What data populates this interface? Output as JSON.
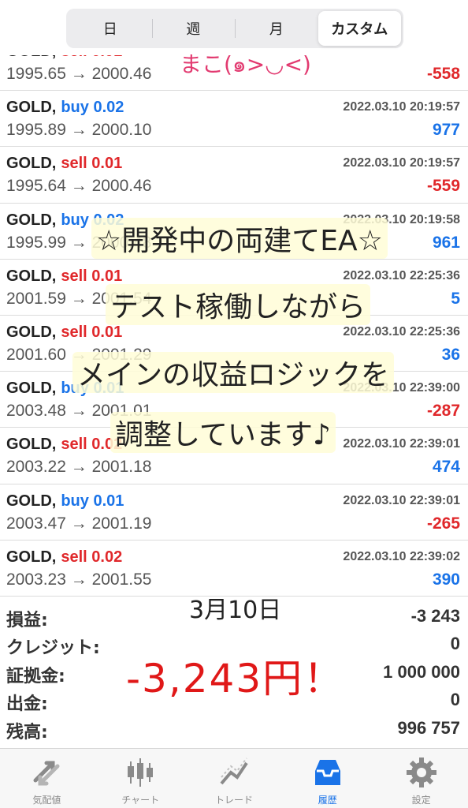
{
  "segments": [
    {
      "label": "日",
      "active": false
    },
    {
      "label": "週",
      "active": false
    },
    {
      "label": "月",
      "active": false
    },
    {
      "label": "カスタム",
      "active": true
    }
  ],
  "deals": [
    {
      "symbol": "GOLD,",
      "dir": "sell",
      "vol": "0.01",
      "time": "",
      "prices": "1995.65 → 2000.46",
      "profit": "-558",
      "sign": "neg"
    },
    {
      "symbol": "GOLD,",
      "dir": "buy",
      "vol": "0.02",
      "time": "2022.03.10 20:19:57",
      "prices": "1995.89 → 2000.10",
      "profit": "977",
      "sign": "pos"
    },
    {
      "symbol": "GOLD,",
      "dir": "sell",
      "vol": "0.01",
      "time": "2022.03.10 20:19:57",
      "prices": "1995.64 → 2000.46",
      "profit": "-559",
      "sign": "neg"
    },
    {
      "symbol": "GOLD,",
      "dir": "buy",
      "vol": "0.02",
      "time": "2022.03.10 20:19:58",
      "prices": "1995.99 → 2000.48",
      "profit": "961",
      "sign": "pos"
    },
    {
      "symbol": "GOLD,",
      "dir": "sell",
      "vol": "0.01",
      "time": "2022.03.10 22:25:36",
      "prices": "2001.59 → 2001.54",
      "profit": "5",
      "sign": "pos"
    },
    {
      "symbol": "GOLD,",
      "dir": "sell",
      "vol": "0.01",
      "time": "2022.03.10 22:25:36",
      "prices": "2001.60 → 2001.29",
      "profit": "36",
      "sign": "pos"
    },
    {
      "symbol": "GOLD,",
      "dir": "buy",
      "vol": "0.01",
      "time": "2022.03.10 22:39:00",
      "prices": "2003.48 → 2001.01",
      "profit": "-287",
      "sign": "neg"
    },
    {
      "symbol": "GOLD,",
      "dir": "sell",
      "vol": "0.02",
      "time": "2022.03.10 22:39:01",
      "prices": "2003.22 → 2001.18",
      "profit": "474",
      "sign": "pos"
    },
    {
      "symbol": "GOLD,",
      "dir": "buy",
      "vol": "0.01",
      "time": "2022.03.10 22:39:01",
      "prices": "2003.47 → 2001.19",
      "profit": "-265",
      "sign": "neg"
    },
    {
      "symbol": "GOLD,",
      "dir": "sell",
      "vol": "0.02",
      "time": "2022.03.10 22:39:02",
      "prices": "2003.23 → 2001.55",
      "profit": "390",
      "sign": "pos"
    }
  ],
  "summary": [
    {
      "label": "損益:",
      "value": "-3 243"
    },
    {
      "label": "クレジット:",
      "value": "0"
    },
    {
      "label": "証拠金:",
      "value": "1 000 000"
    },
    {
      "label": "出金:",
      "value": "0"
    },
    {
      "label": "残高:",
      "value": "996 757"
    }
  ],
  "tabs": [
    {
      "label": "気配値",
      "icon": "quotes-arrows-icon",
      "active": false
    },
    {
      "label": "チャート",
      "icon": "candlestick-chart-icon",
      "active": false
    },
    {
      "label": "トレード",
      "icon": "trade-trend-icon",
      "active": false
    },
    {
      "label": "履歴",
      "icon": "history-inbox-icon",
      "active": true
    },
    {
      "label": "設定",
      "icon": "settings-gear-icon",
      "active": false
    }
  ],
  "overlay": {
    "sign": "まこ(๑>◡<)",
    "line1": "☆開発中の両建てEA☆",
    "line2": "テスト稼働しながら",
    "line3": "メインの収益ロジックを",
    "line4": "調整しています♪",
    "date": "3月10日",
    "big": "-3,243円！"
  },
  "colors": {
    "buy": "#1a73e8",
    "sell": "#e0282b",
    "accent": "#1a73e8"
  }
}
